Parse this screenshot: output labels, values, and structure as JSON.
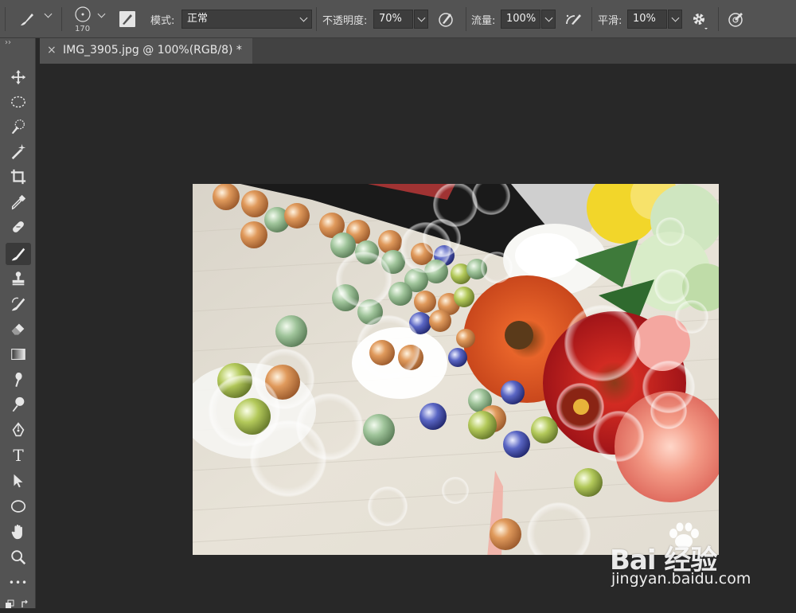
{
  "options_bar": {
    "brush_size": "170",
    "mode_label": "模式:",
    "mode_value": "正常",
    "opacity_label": "不透明度:",
    "opacity_value": "70%",
    "flow_label": "流量:",
    "flow_value": "100%",
    "smoothing_label": "平滑:",
    "smoothing_value": "10%"
  },
  "document_tab": {
    "close_symbol": "×",
    "title": "IMG_3905.jpg @ 100%(RGB/8) *"
  },
  "toolbar": {
    "collapse_symbol": "››",
    "active_tool": "brush-tool",
    "tools": [
      "move-tool",
      "elliptical-marquee-tool",
      "quick-selection-tool",
      "magic-wand-tool",
      "crop-tool",
      "eyedropper-tool",
      "healing-brush-tool",
      "brush-tool",
      "clone-stamp-tool",
      "history-brush-tool",
      "eraser-tool",
      "gradient-tool",
      "smudge-tool",
      "dodge-tool",
      "pen-tool",
      "type-tool",
      "path-selection-tool",
      "ellipse-tool",
      "hand-tool",
      "zoom-tool",
      "more-tools"
    ],
    "type_tool_glyph": "T",
    "more_glyph": "•••"
  },
  "watermark": {
    "logo_text": "Bai 经验",
    "url": "jingyan.baidu.com"
  },
  "colors": {
    "panel": "#535353",
    "workspace": "#282828",
    "field": "#3d3d3d"
  }
}
